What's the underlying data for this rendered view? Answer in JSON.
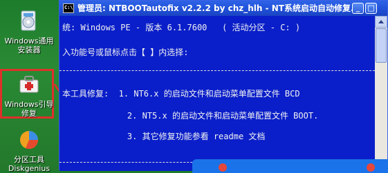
{
  "desktop": {
    "icons": [
      {
        "label": "Windows通用\n安装器",
        "icon": "installer-icon"
      },
      {
        "label": "Windows引导\n修复",
        "icon": "boot-repair-icon"
      },
      {
        "label": "分区工具\nDiskgenius",
        "icon": "diskgenius-icon"
      }
    ]
  },
  "window": {
    "title": "管理员: NTBOOTautofix v2.2.2 by chz_hlh - NT系统启动自动修复...",
    "lines": [
      "统: Windows PE - 版本 6.1.7600   ( 活动分区 - C: )",
      "入功能号或鼠标点击【 】内选择:",
      "本工具修复:  1. NT6.x 的启动文件和启动菜单配置文件 BCD",
      "             2. NT5.x 的启动文件和启动菜单配置文件 BOOT.",
      "             3. 其它修复功能参看 readme 文档"
    ],
    "min_label": "_",
    "max_label": "□"
  },
  "colors": {
    "desktop_bg": "#23782c",
    "console_bg": "#0a1fc9",
    "highlight": "#e0302a"
  }
}
